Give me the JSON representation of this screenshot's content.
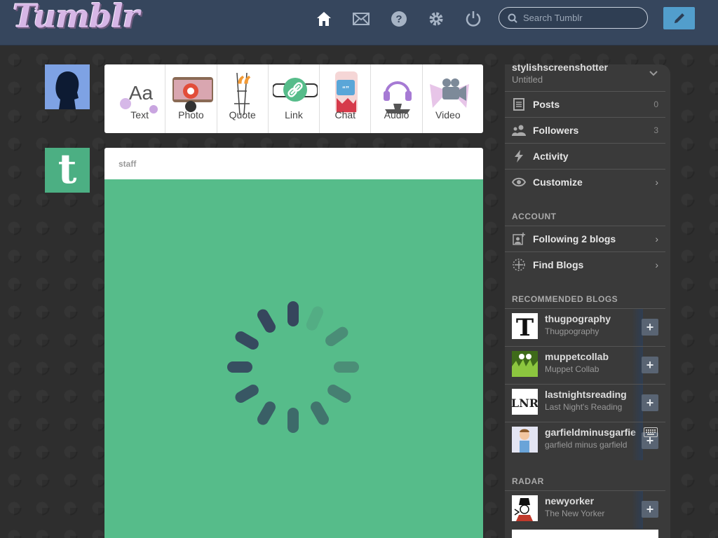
{
  "header": {
    "logo": "Tumblr",
    "search_placeholder": "Search Tumblr"
  },
  "nav_icons": [
    "home-icon",
    "mail-icon",
    "help-icon",
    "gear-icon",
    "power-icon"
  ],
  "post_types": [
    {
      "label": "Text",
      "icon": "text-icon"
    },
    {
      "label": "Photo",
      "icon": "camera-icon"
    },
    {
      "label": "Quote",
      "icon": "quote-icon"
    },
    {
      "label": "Link",
      "icon": "link-icon"
    },
    {
      "label": "Chat",
      "icon": "chat-icon"
    },
    {
      "label": "Audio",
      "icon": "headphones-icon"
    },
    {
      "label": "Video",
      "icon": "video-camera-icon"
    }
  ],
  "post": {
    "author": "staff",
    "background": "#56bc8a"
  },
  "sidebar": {
    "blog_name": "stylishscreenshotter",
    "blog_title": "Untitled",
    "menu": [
      {
        "label": "Posts",
        "count": "0",
        "icon": "posts-icon"
      },
      {
        "label": "Followers",
        "count": "3",
        "icon": "followers-icon"
      },
      {
        "label": "Activity",
        "count": "",
        "icon": "lightning-icon"
      },
      {
        "label": "Customize",
        "count": "",
        "icon": "eye-icon"
      }
    ],
    "account_heading": "ACCOUNT",
    "account": [
      {
        "label": "Following 2 blogs",
        "icon": "add-contact-icon"
      },
      {
        "label": "Find Blogs",
        "icon": "compass-icon"
      }
    ],
    "recommended_heading": "RECOMMENDED BLOGS",
    "recommended": [
      {
        "name": "thugpography",
        "title": "Thugpography"
      },
      {
        "name": "muppetcollab",
        "title": "Muppet Collab"
      },
      {
        "name": "lastnightsreading",
        "title": "Last Night's Reading"
      },
      {
        "name": "garfieldminusgarfie",
        "title": "garfield minus garfield",
        "overlay": "dashboard"
      }
    ],
    "radar_heading": "RADAR",
    "radar": [
      {
        "name": "newyorker",
        "title": "The New Yorker"
      }
    ]
  },
  "colors": {
    "header": "#36465d",
    "accent": "#529ecc",
    "staff_green": "#4caf83"
  }
}
